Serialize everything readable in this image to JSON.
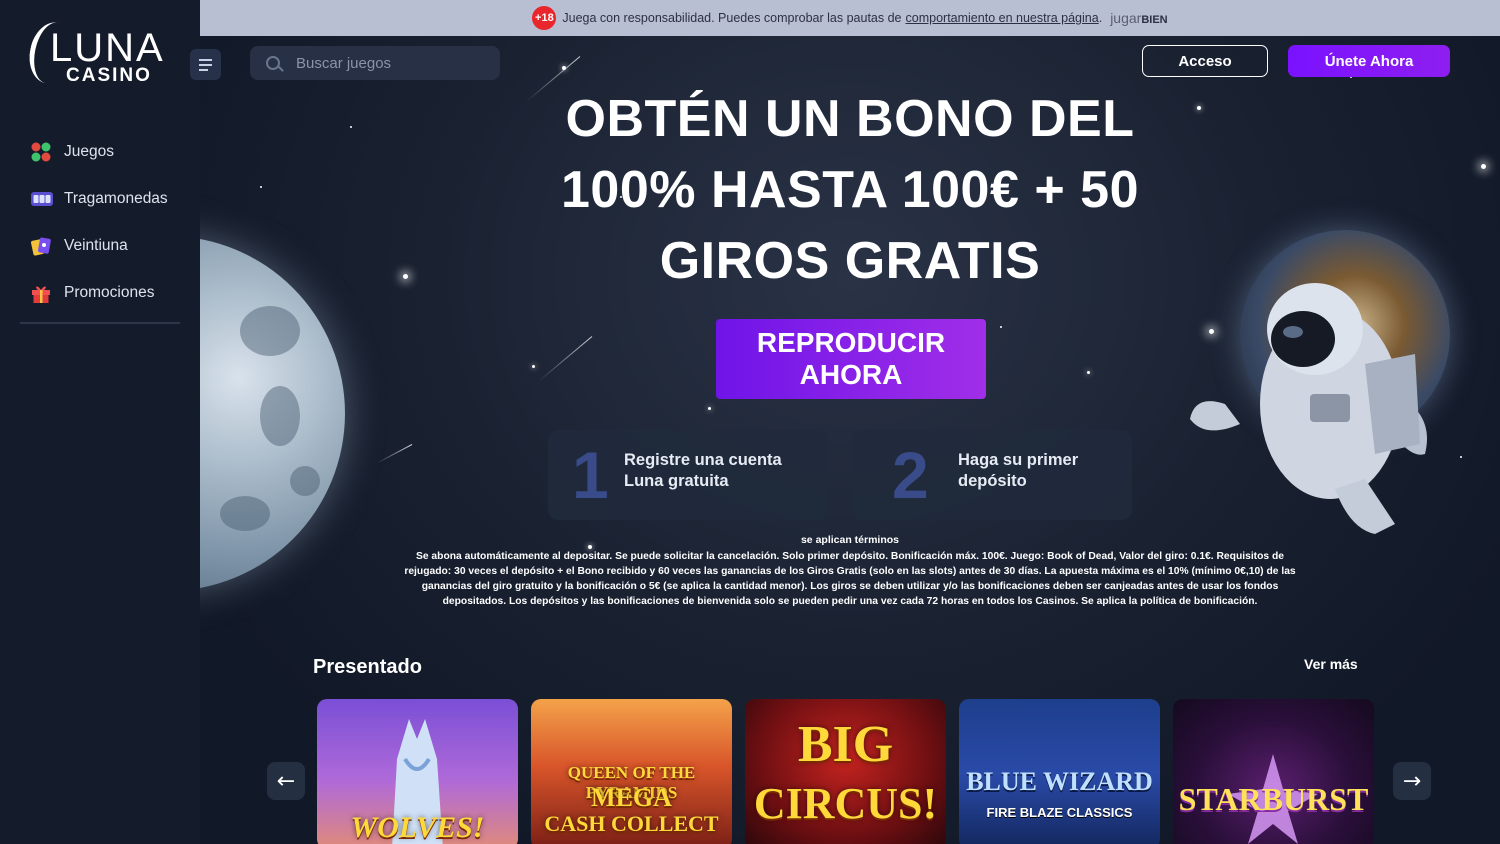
{
  "brand": {
    "logo_top": "LUNA",
    "logo_bottom": "CASINO"
  },
  "sidebar": {
    "items": [
      {
        "label": "Juegos",
        "icon": "games-icon"
      },
      {
        "label": "Tragamonedas",
        "icon": "slot-machine-icon"
      },
      {
        "label": "Veintiuna",
        "icon": "cards-icon"
      },
      {
        "label": "Promociones",
        "icon": "gift-icon"
      }
    ]
  },
  "topbar": {
    "age_badge": "+18",
    "text": "Juega con responsabilidad. Puedes comprobar las pautas de",
    "link": "comportamiento en nuestra página",
    "partner_a": "jugar",
    "partner_b": "BIEN"
  },
  "header": {
    "search_placeholder": "Buscar juegos",
    "login_label": "Acceso",
    "join_label": "Únete Ahora"
  },
  "hero": {
    "headline_line1": "OBTÉN UN BONO DEL",
    "headline_line2": "100% HASTA 100€ + 50",
    "headline_line3": "GIROS GRATIS",
    "cta_line1": "REPRODUCIR",
    "cta_line2": "AHORA",
    "steps": [
      {
        "num": "1",
        "text": "Registre una cuenta Luna gratuita"
      },
      {
        "num": "2",
        "text": "Haga su primer depósito"
      }
    ],
    "terms_heading": "se aplican términos",
    "terms_text": "Se abona automáticamente al depositar. Se puede solicitar la cancelación. Solo primer depósito. Bonificación máx. 100€. Juego: Book of Dead, Valor del giro: 0.1€. Requisitos de rejugado: 30 veces el depósito + el Bono recibido y 60 veces las ganancias de los Giros Gratis (solo en las slots) antes de 30 días. La apuesta máxima es el 10% (mínimo 0€,10) de las ganancias del giro gratuito y la bonificación o 5€ (se aplica la cantidad menor). Los giros se deben utilizar y/o las bonificaciones deben ser canjeadas antes de usar los fondos depositados. Los depósitos y las bonificaciones de bienvenida solo se pueden pedir una vez cada 72 horas en todos los Casinos. Se aplica la política de bonificación."
  },
  "featured": {
    "title": "Presentado",
    "see_more": "Ver más",
    "games": [
      {
        "title": "WOLVES!"
      },
      {
        "title_top": "QUEEN OF THE PYRAMIDS",
        "title_mid": "MEGA",
        "title_bottom": "CASH COLLECT"
      },
      {
        "title_top": "BIG",
        "title_bottom": "CIRCUS!"
      },
      {
        "title": "BLUE WIZARD",
        "subtitle": "FIRE BLAZE CLASSICS"
      },
      {
        "title": "STARBURST"
      }
    ]
  },
  "colors": {
    "accent": "#7a12ff",
    "sidebar": "#141c2b",
    "topbar": "#b9bfd3"
  }
}
